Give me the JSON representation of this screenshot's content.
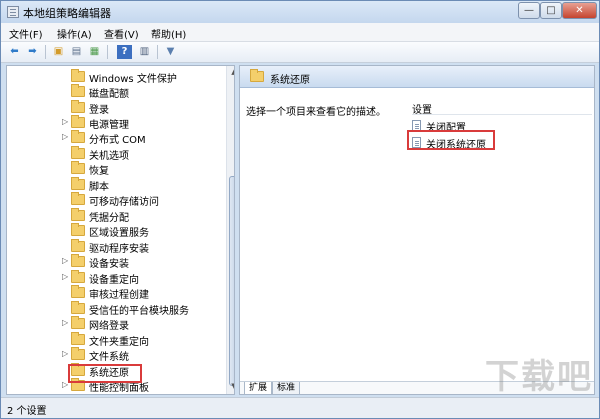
{
  "window": {
    "title": "本地组策略编辑器"
  },
  "controls": {
    "min": "—",
    "max": "□",
    "close": "✕"
  },
  "menu": [
    {
      "label": "文件(F)"
    },
    {
      "label": "操作(A)"
    },
    {
      "label": "查看(V)"
    },
    {
      "label": "帮助(H)"
    }
  ],
  "toolbar": {
    "back_icon": "back-arrow-icon",
    "forward_icon": "forward-arrow-icon",
    "up_icon": "up-folder-icon",
    "show_hide_tree_icon": "show-hide-tree-icon",
    "export_icon": "export-list-icon",
    "help_icon": "help-icon",
    "properties_icon": "properties-icon",
    "filter_icon": "filter-icon"
  },
  "tree": {
    "items": [
      {
        "label": "Windows 文件保护",
        "expander": ""
      },
      {
        "label": "磁盘配额",
        "expander": ""
      },
      {
        "label": "登录",
        "expander": ""
      },
      {
        "label": "电源管理",
        "expander": "▷"
      },
      {
        "label": "分布式 COM",
        "expander": "▷"
      },
      {
        "label": "关机选项",
        "expander": ""
      },
      {
        "label": "恢复",
        "expander": ""
      },
      {
        "label": "脚本",
        "expander": ""
      },
      {
        "label": "可移动存储访问",
        "expander": ""
      },
      {
        "label": "凭据分配",
        "expander": ""
      },
      {
        "label": "区域设置服务",
        "expander": ""
      },
      {
        "label": "驱动程序安装",
        "expander": ""
      },
      {
        "label": "设备安装",
        "expander": "▷"
      },
      {
        "label": "设备重定向",
        "expander": "▷"
      },
      {
        "label": "审核过程创建",
        "expander": ""
      },
      {
        "label": "受信任的平台模块服务",
        "expander": ""
      },
      {
        "label": "网络登录",
        "expander": "▷"
      },
      {
        "label": "文件夹重定向",
        "expander": ""
      },
      {
        "label": "文件系统",
        "expander": "▷"
      },
      {
        "label": "系统还原",
        "expander": ""
      },
      {
        "label": "性能控制面板",
        "expander": "▷"
      }
    ]
  },
  "right": {
    "header_title": "系统还原",
    "description": "选择一个项目来查看它的描述。",
    "column_header": "设置",
    "settings": [
      {
        "label": "关闭配置"
      },
      {
        "label": "关闭系统还原"
      }
    ],
    "tabs": [
      {
        "label": "扩展"
      },
      {
        "label": "标准"
      }
    ]
  },
  "status": {
    "text": "2 个设置"
  },
  "watermark": "下载吧"
}
